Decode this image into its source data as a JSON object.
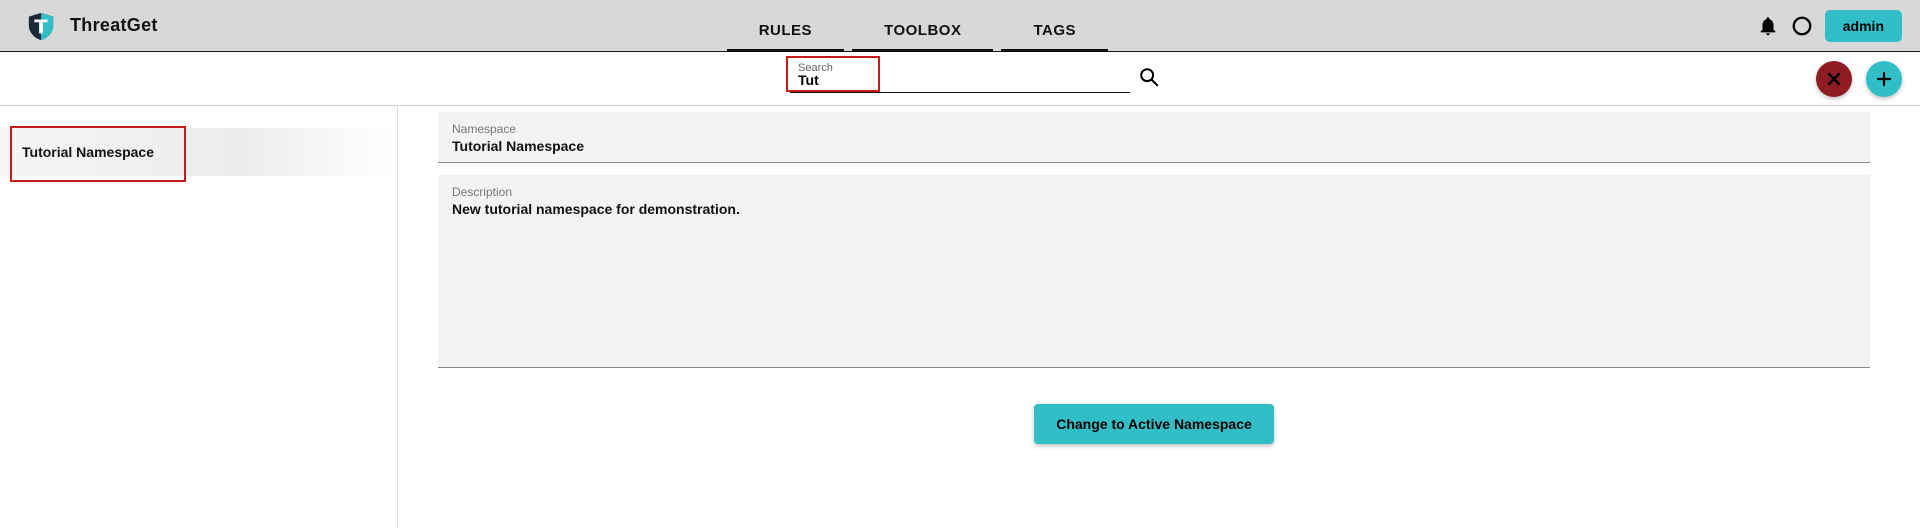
{
  "header": {
    "app_title": "ThreatGet",
    "nav": {
      "rules": "RULES",
      "toolbox": "TOOLBOX",
      "tags": "TAGS"
    },
    "admin_label": "admin"
  },
  "search": {
    "label": "Search",
    "value": "Tut"
  },
  "sidebar": {
    "items": [
      {
        "label": "Tutorial Namespace"
      }
    ]
  },
  "details": {
    "namespace_label": "Namespace",
    "namespace_value": "Tutorial Namespace",
    "description_label": "Description",
    "description_value": "New tutorial namespace for demonstration.",
    "action_label": "Change to Active Namespace"
  },
  "colors": {
    "accent": "#31bec7",
    "danger": "#8f1b23",
    "highlight": "#c91a1a"
  }
}
